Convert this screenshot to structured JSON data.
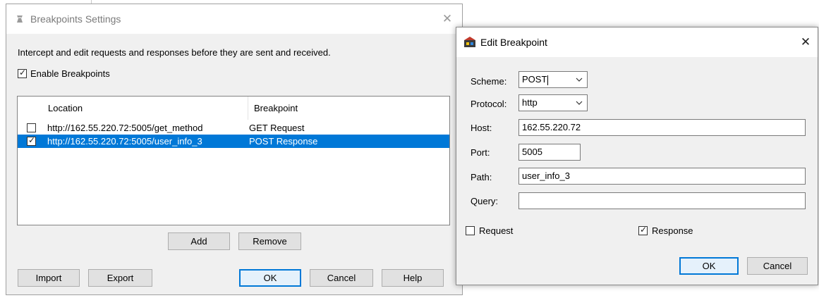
{
  "settings_dialog": {
    "title": "Breakpoints Settings",
    "description": "Intercept and edit requests and responses before they are sent and received.",
    "enable_label": "Enable Breakpoints",
    "enable_checked": true,
    "columns": {
      "location": "Location",
      "breakpoint": "Breakpoint"
    },
    "rows": [
      {
        "checked": false,
        "location": "http://162.55.220.72:5005/get_method",
        "breakpoint": "GET Request"
      },
      {
        "checked": true,
        "location": "http://162.55.220.72:5005/user_info_3",
        "breakpoint": "POST Response"
      }
    ],
    "buttons": {
      "add": "Add",
      "remove": "Remove",
      "import": "Import",
      "export": "Export",
      "ok": "OK",
      "cancel": "Cancel",
      "help": "Help"
    }
  },
  "edit_dialog": {
    "title": "Edit Breakpoint",
    "labels": {
      "scheme": "Scheme:",
      "protocol": "Protocol:",
      "host": "Host:",
      "port": "Port:",
      "path": "Path:",
      "query": "Query:"
    },
    "values": {
      "scheme": "POST",
      "protocol": "http",
      "host": "162.55.220.72",
      "port": "5005",
      "path": "user_info_3",
      "query": ""
    },
    "request_label": "Request",
    "request_checked": false,
    "response_label": "Response",
    "response_checked": true,
    "buttons": {
      "ok": "OK",
      "cancel": "Cancel"
    }
  },
  "colors": {
    "selection": "#0078d7",
    "dialog_bg": "#f0f0f0",
    "default_button_border": "#0078d7"
  }
}
